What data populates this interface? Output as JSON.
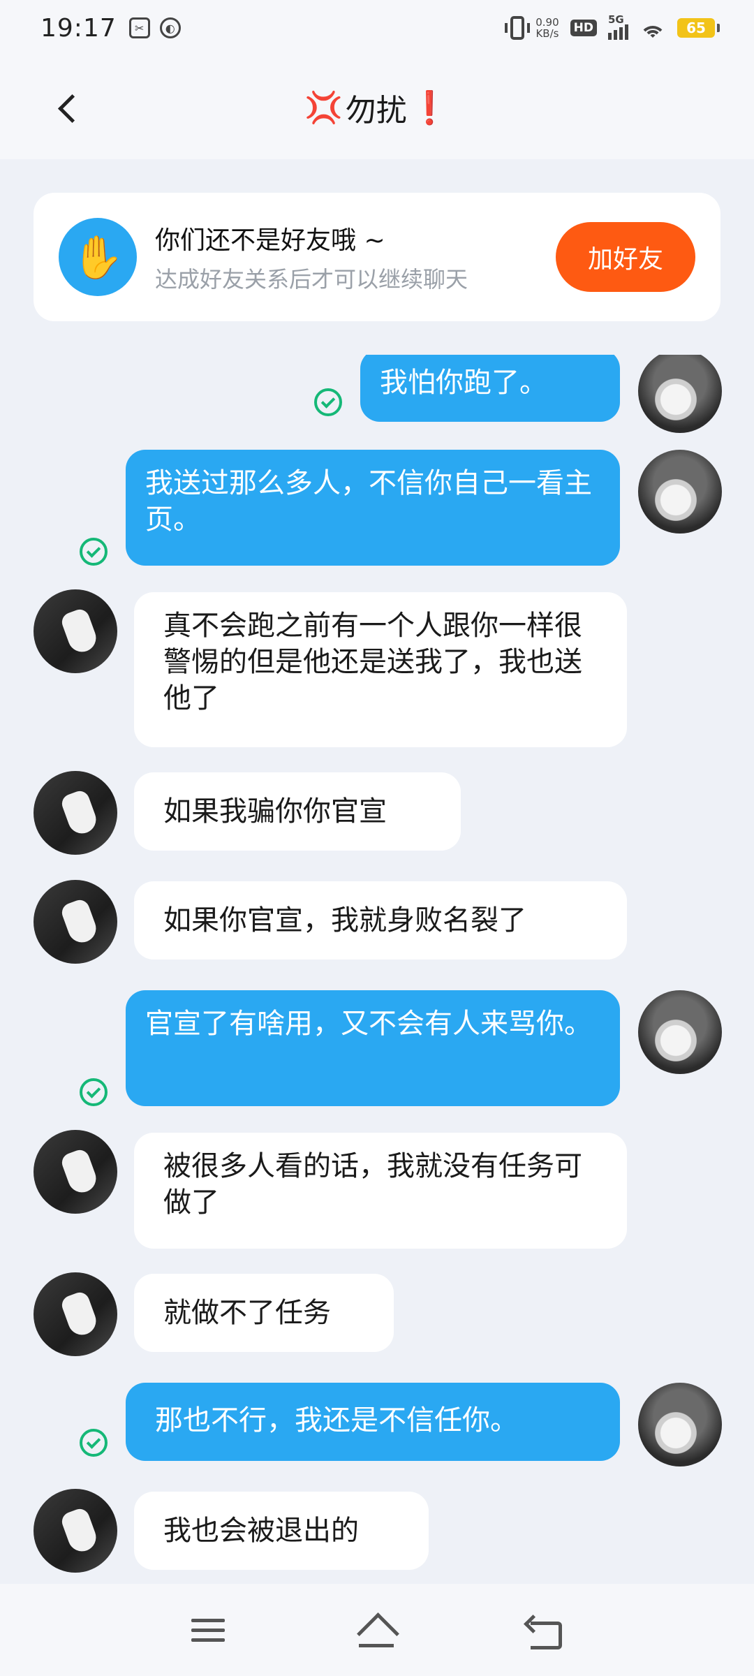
{
  "status_bar": {
    "time": "19:17",
    "net_speed_value": "0.90",
    "net_speed_unit": "KB/s",
    "hd": "HD",
    "network": "5G",
    "battery": "65"
  },
  "header": {
    "title": "勿扰"
  },
  "friend_card": {
    "title": "你们还不是好友哦 ~",
    "subtitle": "达成好友关系后才可以继续聊天",
    "button": "加好友"
  },
  "messages": [
    {
      "side": "sent",
      "text": "我怕你跑了。",
      "read": true
    },
    {
      "side": "sent",
      "text": "我送过那么多人，不信你自己一看主页。",
      "read": true
    },
    {
      "side": "received",
      "text": "真不会跑之前有一个人跟你一样很警惕的但是他还是送我了，我也送他了"
    },
    {
      "side": "received",
      "text": "如果我骗你你官宣"
    },
    {
      "side": "received",
      "text": "如果你官宣，我就身败名裂了"
    },
    {
      "side": "sent",
      "text": "官宣了有啥用，又不会有人来骂你。",
      "read": true
    },
    {
      "side": "received",
      "text": "被很多人看的话，我就没有任务可做了"
    },
    {
      "side": "received",
      "text": "就做不了任务"
    },
    {
      "side": "sent",
      "text": "那也不行，我还是不信任你。",
      "read": true
    },
    {
      "side": "received",
      "text": "我也会被退出的"
    }
  ],
  "icons": {
    "anger": "💢",
    "exclamation": "❗",
    "hand": "✋"
  },
  "colors": {
    "sent_bubble": "#2aa8f2",
    "add_friend_button": "#fe5a12",
    "read_check": "#15b877"
  }
}
